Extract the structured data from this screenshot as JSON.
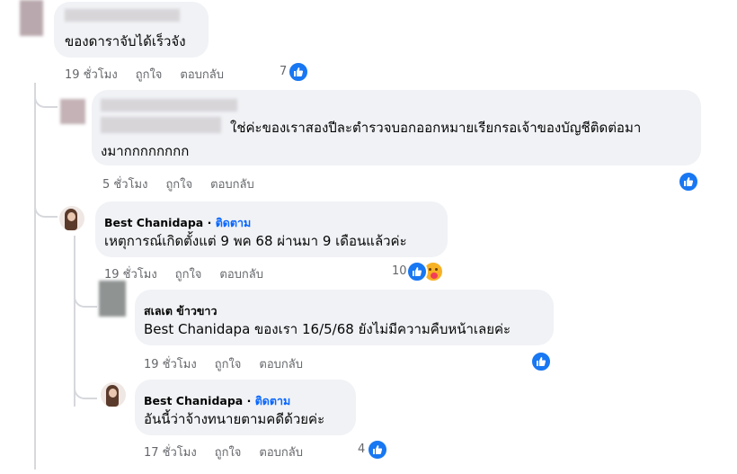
{
  "comments": [
    {
      "text_lines": [
        "ของดาราจับได้เร็วจัง"
      ],
      "time": "19 ชั่วโมง",
      "like_label": "ถูกใจ",
      "reply_label": "ตอบกลับ",
      "reactions": "7"
    },
    {
      "text_lines": [
        "ใช่ค่ะของเราสองปีละตำรวจบอกออกหมายเรียกรอเจ้าของบัญชีติดต่อมา",
        "งมากกกกกกกก"
      ],
      "time": "5 ชั่วโมง",
      "like_label": "ถูกใจ",
      "reply_label": "ตอบกลับ"
    },
    {
      "author": "Best Chanidapa",
      "follow_label": "ติดตาม",
      "text_lines": [
        "เหตุการณ์เกิดตั้งแต่ 9 พค 68 ผ่านมา 9 เดือนแล้วค่ะ"
      ],
      "time": "19 ชั่วโมง",
      "like_label": "ถูกใจ",
      "reply_label": "ตอบกลับ",
      "reactions": "10"
    },
    {
      "author": "สเลเต ข้าวขาว",
      "text_lines": [
        "Best Chanidapa ของเรา 16/5/68 ยังไม่มีความคืบหน้าเลยค่ะ"
      ],
      "time": "19 ชั่วโมง",
      "like_label": "ถูกใจ",
      "reply_label": "ตอบกลับ"
    },
    {
      "author": "Best Chanidapa",
      "follow_label": "ติดตาม",
      "text_lines": [
        "อันนี้ว่าจ้างทนายตามคดีด้วยค่ะ"
      ],
      "time": "17 ชั่วโมง",
      "like_label": "ถูกใจ",
      "reply_label": "ตอบกลับ",
      "reactions": "4"
    }
  ],
  "colors": {
    "bubble": "#f0f2f5",
    "like_blue": "#1877f2",
    "follow": "#0866ff",
    "meta": "#65676b"
  },
  "icons": {
    "like": "thumbs-up-icon",
    "care": "care-reaction-icon"
  }
}
